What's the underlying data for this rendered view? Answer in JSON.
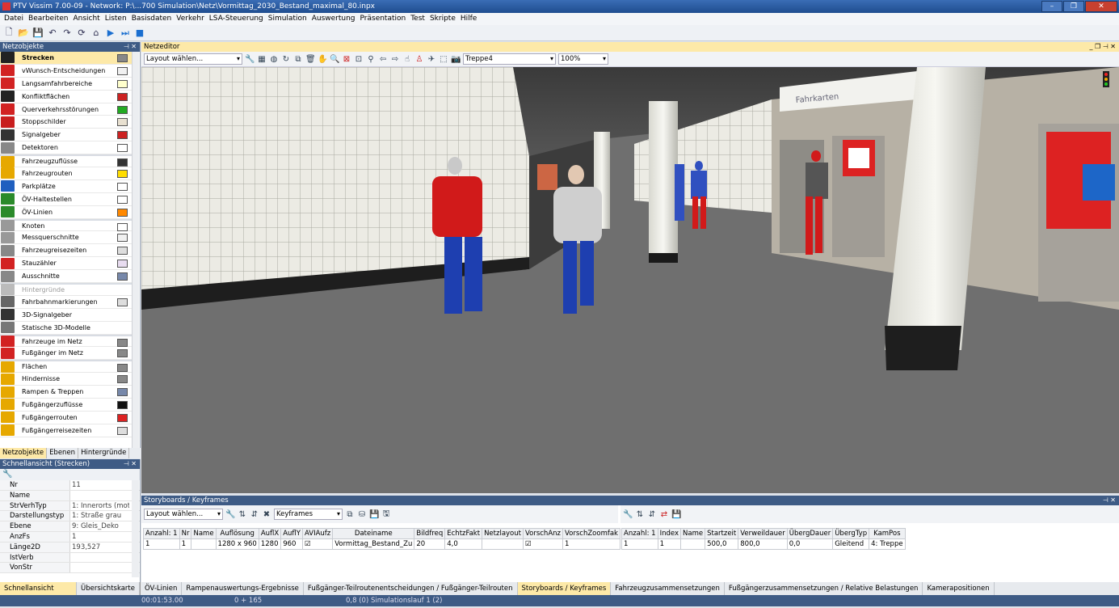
{
  "window": {
    "title": "PTV Vissim 7.00-09 - Network: P:\\...700 Simulation\\Netz\\Vormittag_2030_Bestand_maximal_80.inpx"
  },
  "menu": [
    "Datei",
    "Bearbeiten",
    "Ansicht",
    "Listen",
    "Basisdaten",
    "Verkehr",
    "LSA-Steuerung",
    "Simulation",
    "Auswertung",
    "Präsentation",
    "Test",
    "Skripte",
    "Hilfe"
  ],
  "left_panel": {
    "title": "Netzobjekte",
    "items": [
      {
        "label": "Strecken",
        "icon": "road-icon",
        "color": "#222222",
        "swatch": "#888888"
      },
      {
        "label": "vWunsch-Entscheidungen",
        "icon": "speed-sign-icon",
        "color": "#d22222",
        "swatch": "#f0f0f0"
      },
      {
        "label": "Langsamfahrbereiche",
        "icon": "warning-triangle-icon",
        "color": "#d22222",
        "swatch": "#ffffcc"
      },
      {
        "label": "Konfliktflächen",
        "icon": "conflict-icon",
        "color": "#222222",
        "swatch": "#cc2222"
      },
      {
        "label": "Querverkehrsstörungen",
        "icon": "yield-icon",
        "color": "#d22222",
        "swatch": "#22aa22"
      },
      {
        "label": "Stoppschilder",
        "icon": "stop-sign-icon",
        "color": "#c81e1e",
        "swatch": "#e8e0d0"
      },
      {
        "label": "Signalgeber",
        "icon": "signal-icon",
        "color": "#333333",
        "swatch": "#cc2222"
      },
      {
        "label": "Detektoren",
        "icon": "detector-icon",
        "color": "#888888",
        "swatch": "#ffffff"
      },
      {
        "label": "Fahrzeugzuflüsse",
        "icon": "vehicle-input-icon",
        "color": "#e6a800",
        "swatch": "#333333"
      },
      {
        "label": "Fahrzeugrouten",
        "icon": "vehicle-route-icon",
        "color": "#e6a800",
        "swatch": "#ffdd00"
      },
      {
        "label": "Parkplätze",
        "icon": "parking-icon",
        "color": "#1f5fbf",
        "swatch": "#ffffff"
      },
      {
        "label": "ÖV-Haltestellen",
        "icon": "bus-stop-icon",
        "color": "#2a8a2a",
        "swatch": "#ffffff"
      },
      {
        "label": "ÖV-Linien",
        "icon": "bus-line-icon",
        "color": "#2a8a2a",
        "swatch": "#ff8800"
      },
      {
        "label": "Knoten",
        "icon": "node-icon",
        "color": "#999999",
        "swatch": "#ffffff"
      },
      {
        "label": "Messquerschnitte",
        "icon": "measurement-icon",
        "color": "#999999",
        "swatch": "#f0f0f0"
      },
      {
        "label": "Fahrzeugreisezeiten",
        "icon": "travel-time-icon",
        "color": "#888888",
        "swatch": "#dddddd"
      },
      {
        "label": "Stauzähler",
        "icon": "queue-counter-icon",
        "color": "#d22222",
        "swatch": "#e8dcf0"
      },
      {
        "label": "Ausschnitte",
        "icon": "section-icon",
        "color": "#888888",
        "swatch": "#7788aa"
      },
      {
        "label": "Hintergründe",
        "icon": "background-icon",
        "color": "#bbbbbb",
        "swatch": ""
      },
      {
        "label": "Fahrbahnmarkierungen",
        "icon": "road-marking-icon",
        "color": "#666666",
        "swatch": "#dddddd"
      },
      {
        "label": "3D-Signalgeber",
        "icon": "signal-3d-icon",
        "color": "#333333",
        "swatch": ""
      },
      {
        "label": "Statische 3D-Modelle",
        "icon": "static-model-icon",
        "color": "#777777",
        "swatch": ""
      },
      {
        "label": "Fahrzeuge im Netz",
        "icon": "vehicles-in-network-icon",
        "color": "#d22222",
        "swatch": "#888888"
      },
      {
        "label": "Fußgänger im Netz",
        "icon": "pedestrians-in-network-icon",
        "color": "#d22222",
        "swatch": "#888888"
      },
      {
        "label": "Flächen",
        "icon": "area-icon",
        "color": "#e6a800",
        "swatch": "#888888"
      },
      {
        "label": "Hindernisse",
        "icon": "obstacle-icon",
        "color": "#e6a800",
        "swatch": "#888888"
      },
      {
        "label": "Rampen & Treppen",
        "icon": "ramp-icon",
        "color": "#e6a800",
        "swatch": "#7788aa"
      },
      {
        "label": "Fußgängerzuflüsse",
        "icon": "pedestrian-input-icon",
        "color": "#e6a800",
        "swatch": "#111111"
      },
      {
        "label": "Fußgängerrouten",
        "icon": "pedestrian-route-icon",
        "color": "#e6a800",
        "swatch": "#dd2222"
      },
      {
        "label": "Fußgängerreisezeiten",
        "icon": "pedestrian-travel-time-icon",
        "color": "#e6a800",
        "swatch": "#dddddd"
      }
    ],
    "tabs": [
      "Netzobjekte",
      "Ebenen",
      "Hintergründe"
    ]
  },
  "quick_view": {
    "title": "Schnellansicht (Strecken)",
    "rows": [
      {
        "key": "Nr",
        "value": "11"
      },
      {
        "key": "Name",
        "value": ""
      },
      {
        "key": "StrVerhTyp",
        "value": "1: Innerorts (mot"
      },
      {
        "key": "Darstellungstyp",
        "value": "1: Straße grau"
      },
      {
        "key": "Ebene",
        "value": "9: Gleis_Deko"
      },
      {
        "key": "AnzFs",
        "value": "1"
      },
      {
        "key": "Länge2D",
        "value": "193,527"
      },
      {
        "key": "IstVerb",
        "value": ""
      },
      {
        "key": "VonStr",
        "value": ""
      }
    ]
  },
  "network_editor": {
    "title": "Netzeditor",
    "layout_placeholder": "Layout wählen...",
    "camera": "Treppe4",
    "zoom": "100%",
    "signs": {
      "fahrkarten": "Fahrkarten"
    }
  },
  "storyboards": {
    "title": "Storyboards / Keyframes",
    "layout_placeholder": "Layout wählen...",
    "combo": "Keyframes",
    "left_headers": [
      "Anzahl: 1",
      "Nr",
      "Name",
      "Auflösung",
      "AuflX",
      "AuflY",
      "AVIAufz",
      "Dateiname",
      "Bildfreq",
      "EchtzFakt",
      "Netzlayout",
      "VorschAnz",
      "VorschZoomfak"
    ],
    "left_row": [
      "1",
      "1",
      "",
      "1280 x 960",
      "1280",
      "960",
      "☑",
      "Vormittag_Bestand_Zu",
      "20",
      "4,0",
      "",
      "☑",
      "1"
    ],
    "right_headers": [
      "Anzahl: 1",
      "Index",
      "Name",
      "Startzeit",
      "Verweildauer",
      "ÜbergDauer",
      "ÜbergTyp",
      "KamPos"
    ],
    "right_row": [
      "1",
      "1",
      "",
      "500,0",
      "800,0",
      "0,0",
      "Gleitend",
      "4: Treppe"
    ]
  },
  "bottom_tabs_left": [
    "Schnellansicht (Streck...",
    "Übersichtskarte"
  ],
  "bottom_tabs": [
    "ÖV-Linien",
    "Rampenauswertungs-Ergebnisse",
    "Fußgänger-Teilroutenentscheidungen / Fußgänger-Teilrouten",
    "Storyboards / Keyframes",
    "Fahrzeugzusammensetzungen",
    "Fußgängerzusammensetzungen / Relative Belastungen",
    "Kamerapositionen"
  ],
  "status": {
    "time": "00:01:53.00",
    "counter": "0 + 165",
    "run": "0,8 (0)  Simulationslauf 1 (2)"
  }
}
